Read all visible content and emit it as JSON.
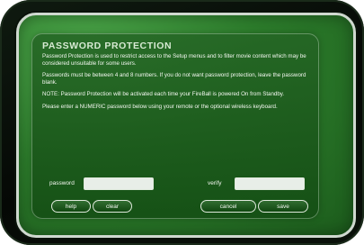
{
  "dialog": {
    "title": "PASSWORD PROTECTION",
    "paragraphs": [
      "Password Protection is used to restrict access to the Setup menus and to filter movie content which may be considered unsuitable for some users.",
      "Passwords must be between 4 and 8 numbers. If you do not want password protection, leave the password blank.",
      "NOTE: Password Protection will be activated each time your FireBall is powered On from Standby.",
      "Please enter a NUMERIC password below using your remote or the optional wireless keyboard."
    ]
  },
  "form": {
    "password_label": "password",
    "password_value": "",
    "verify_label": "verify",
    "verify_value": ""
  },
  "buttons": {
    "help": "help",
    "clear": "clear",
    "cancel": "cancel",
    "save": "save"
  }
}
